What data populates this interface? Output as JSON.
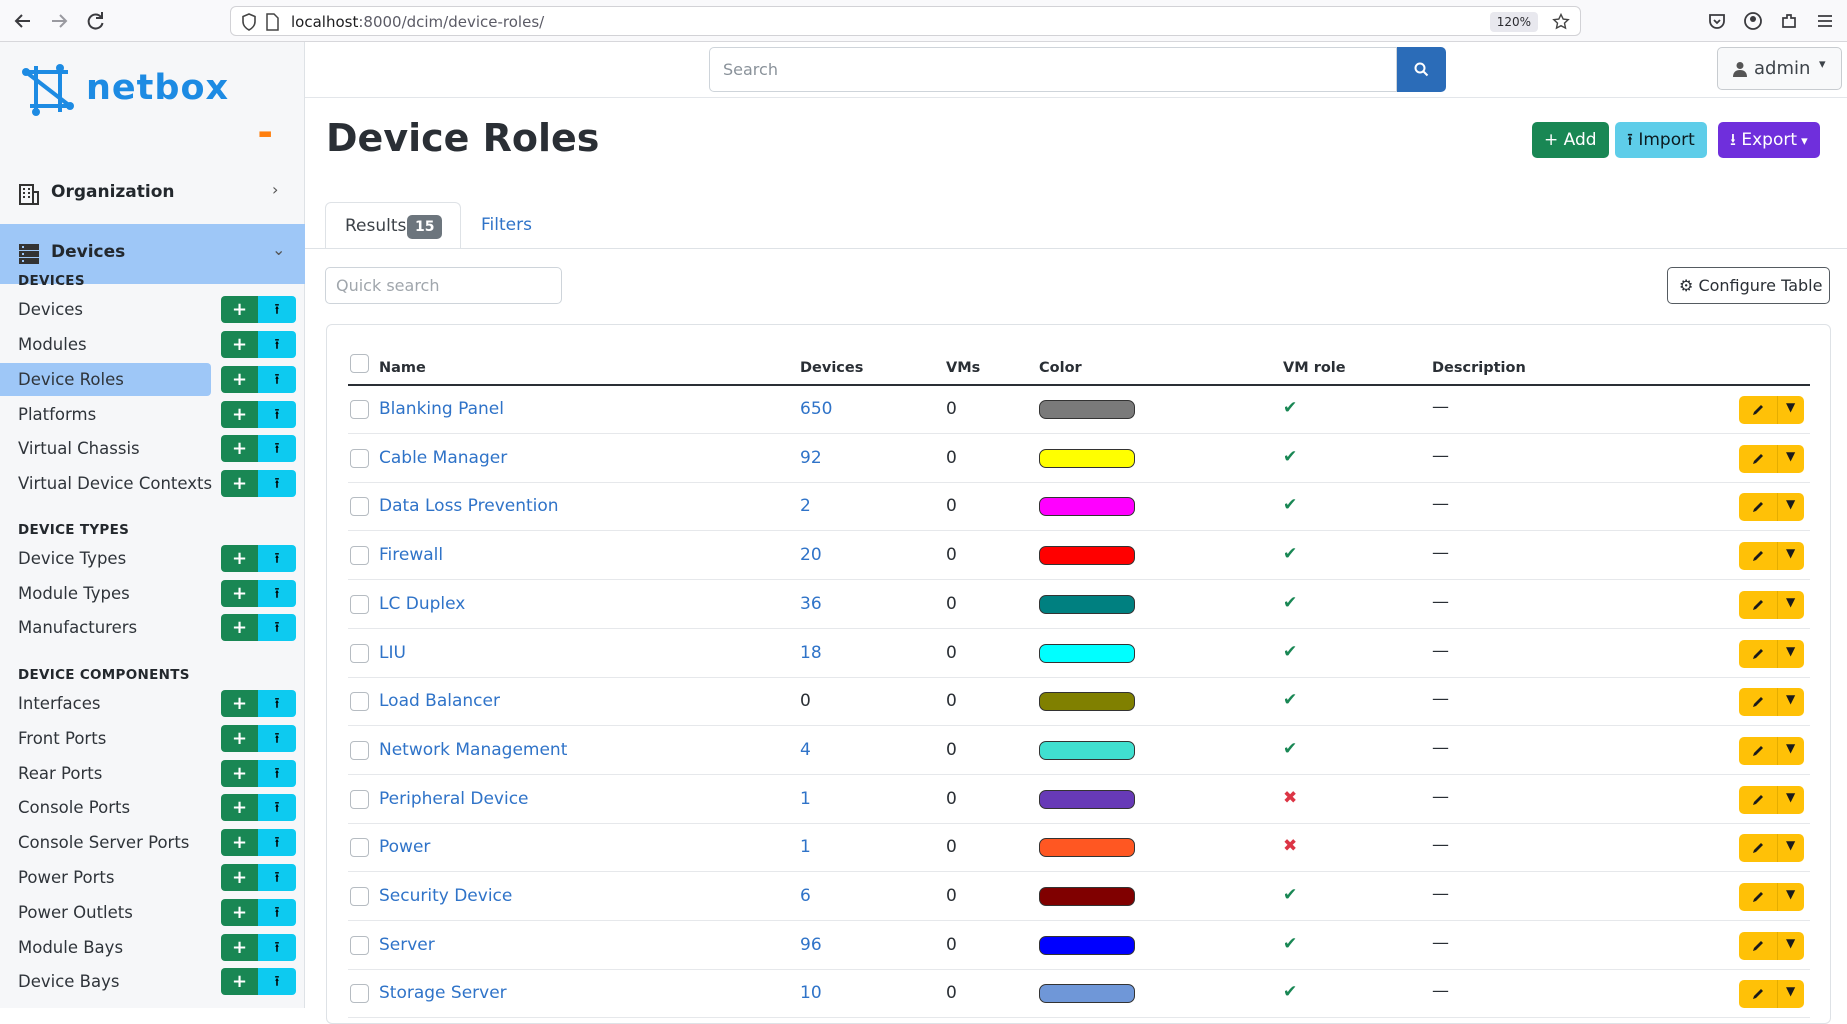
{
  "browser": {
    "url_host": "localhost",
    "url_rest": ":8000/dcim/device-roles/",
    "zoom": "120%"
  },
  "brand": {
    "name": "netbox"
  },
  "sidebar": {
    "menus": [
      {
        "label": "Organization"
      },
      {
        "label": "Devices"
      }
    ],
    "sections": [
      {
        "title": "DEVICES",
        "items": [
          "Devices",
          "Modules",
          "Device Roles",
          "Platforms",
          "Virtual Chassis",
          "Virtual Device Contexts"
        ]
      },
      {
        "title": "DEVICE TYPES",
        "items": [
          "Device Types",
          "Module Types",
          "Manufacturers"
        ]
      },
      {
        "title": "DEVICE COMPONENTS",
        "items": [
          "Interfaces",
          "Front Ports",
          "Rear Ports",
          "Console Ports",
          "Console Server Ports",
          "Power Ports",
          "Power Outlets",
          "Module Bays",
          "Device Bays"
        ]
      }
    ],
    "active_item": "Device Roles"
  },
  "search": {
    "placeholder": "Search"
  },
  "user": {
    "label": "admin"
  },
  "page": {
    "title": "Device Roles",
    "buttons": {
      "add": "Add",
      "import": "Import",
      "export": "Export"
    },
    "tabs": {
      "results": "Results",
      "results_count": "15",
      "filters": "Filters"
    },
    "quick_search_placeholder": "Quick search",
    "configure_table": "Configure Table"
  },
  "table": {
    "columns": [
      "Name",
      "Devices",
      "VMs",
      "Color",
      "VM role",
      "Description"
    ],
    "rows": [
      {
        "name": "Blanking Panel",
        "devices": "650",
        "vms": "0",
        "color": "#7a7a7a",
        "vm_role": true,
        "description": "—"
      },
      {
        "name": "Cable Manager",
        "devices": "92",
        "vms": "0",
        "color": "#ffff00",
        "vm_role": true,
        "description": "—"
      },
      {
        "name": "Data Loss Prevention",
        "devices": "2",
        "vms": "0",
        "color": "#ff00ff",
        "vm_role": true,
        "description": "—"
      },
      {
        "name": "Firewall",
        "devices": "20",
        "vms": "0",
        "color": "#ff0000",
        "vm_role": true,
        "description": "—"
      },
      {
        "name": "LC Duplex",
        "devices": "36",
        "vms": "0",
        "color": "#008080",
        "vm_role": true,
        "description": "—"
      },
      {
        "name": "LIU",
        "devices": "18",
        "vms": "0",
        "color": "#00ffff",
        "vm_role": true,
        "description": "—"
      },
      {
        "name": "Load Balancer",
        "devices": "0",
        "vms": "0",
        "color": "#808000",
        "vm_role": true,
        "description": "—"
      },
      {
        "name": "Network Management",
        "devices": "4",
        "vms": "0",
        "color": "#40e0d0",
        "vm_role": true,
        "description": "—"
      },
      {
        "name": "Peripheral Device",
        "devices": "1",
        "vms": "0",
        "color": "#673ab7",
        "vm_role": false,
        "description": "—"
      },
      {
        "name": "Power",
        "devices": "1",
        "vms": "0",
        "color": "#ff5722",
        "vm_role": false,
        "description": "—"
      },
      {
        "name": "Security Device",
        "devices": "6",
        "vms": "0",
        "color": "#800000",
        "vm_role": true,
        "description": "—"
      },
      {
        "name": "Server",
        "devices": "96",
        "vms": "0",
        "color": "#0000ff",
        "vm_role": true,
        "description": "—"
      },
      {
        "name": "Storage Server",
        "devices": "10",
        "vms": "0",
        "color": "#6f97d8",
        "vm_role": true,
        "description": "—"
      }
    ]
  },
  "icons": {
    "back": "arrow-left-icon",
    "forward": "arrow-right-icon",
    "reload": "reload-icon",
    "search": "search-icon",
    "user": "user-icon",
    "edit": "pencil-icon",
    "check": "check-icon",
    "cross": "x-icon"
  },
  "colors": {
    "accent": "#1d8be3",
    "active": "#9ec7f7",
    "add": "#198754",
    "import": "#0dcaf0",
    "export": "#6f2fdc",
    "edit": "#ffc107"
  }
}
